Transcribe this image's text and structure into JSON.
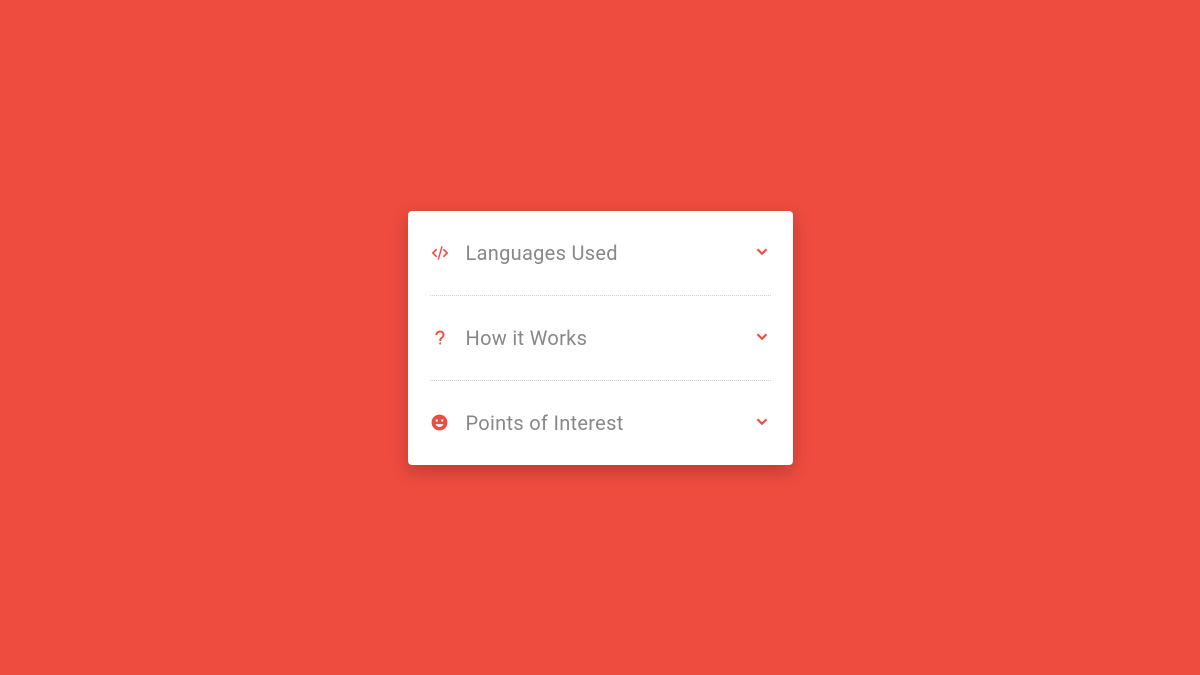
{
  "accordion": {
    "items": [
      {
        "icon": "code-icon",
        "label": "Languages Used"
      },
      {
        "icon": "question-icon",
        "label": "How it Works"
      },
      {
        "icon": "smile-icon",
        "label": "Points of Interest"
      }
    ]
  },
  "colors": {
    "background": "#ee4c3f",
    "card": "#ffffff",
    "accent": "#ee4c3f",
    "text": "#888888"
  }
}
